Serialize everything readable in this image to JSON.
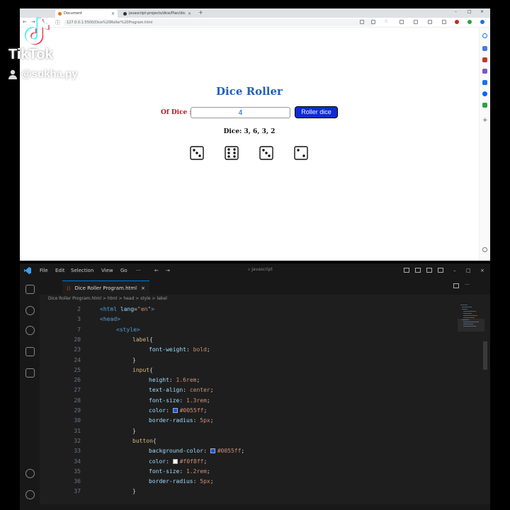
{
  "browser": {
    "tabs": [
      {
        "label": "Document",
        "close": "×"
      },
      {
        "label": "javascript-projects/dice/Plan/dice",
        "close": "×"
      }
    ],
    "new_tab": "+",
    "window_controls": [
      "–",
      "□",
      "×"
    ],
    "url": "127.0.0.1:5500/Dice%20Roller%20Program.html"
  },
  "page": {
    "title": "Dice Roller",
    "dice_label": "Of Dice :",
    "dice_input_value": "4",
    "roll_button": "Roller dice",
    "result_text": "Dice: 3, 6, 3, 2",
    "dice_faces": [
      3,
      6,
      3,
      2
    ]
  },
  "watermark": {
    "brand": "TikTok",
    "username": "@sokha.py"
  },
  "vscode": {
    "menu": [
      "File",
      "Edit",
      "Selection",
      "View",
      "Go",
      "···"
    ],
    "search": "Javascript",
    "tab_label": "Dice Roller Program.html",
    "tab_close": "×",
    "breadcrumb": "Dice Roller Program.html > html > head > style > label",
    "lines": [
      {
        "n": "2",
        "indent": 1,
        "parts": [
          [
            "tag",
            "<html "
          ],
          [
            "prop",
            "lang"
          ],
          [
            "brace",
            "="
          ],
          [
            "val",
            "\"en\""
          ],
          [
            "tag",
            ">"
          ]
        ]
      },
      {
        "n": "3",
        "indent": 1,
        "parts": [
          [
            "tag",
            "<head>"
          ]
        ]
      },
      {
        "n": "7",
        "indent": 2,
        "parts": [
          [
            "tag",
            "<style>"
          ]
        ]
      },
      {
        "n": "20",
        "indent": 3,
        "parts": [
          [
            "sel",
            "label"
          ],
          [
            "brace",
            "{"
          ]
        ]
      },
      {
        "n": "23",
        "indent": 4,
        "parts": [
          [
            "prop",
            "font-weight"
          ],
          [
            "brace",
            ": "
          ],
          [
            "val",
            "bold"
          ],
          [
            "brace",
            ";"
          ]
        ]
      },
      {
        "n": "24",
        "indent": 3,
        "parts": [
          [
            "brace",
            "}"
          ]
        ]
      },
      {
        "n": "25",
        "indent": 3,
        "parts": [
          [
            "sel",
            "input"
          ],
          [
            "brace",
            "{"
          ]
        ]
      },
      {
        "n": "26",
        "indent": 4,
        "parts": [
          [
            "prop",
            "height"
          ],
          [
            "brace",
            ": "
          ],
          [
            "val",
            "1.6rem"
          ],
          [
            "brace",
            ";"
          ]
        ]
      },
      {
        "n": "27",
        "indent": 4,
        "parts": [
          [
            "prop",
            "text-align"
          ],
          [
            "brace",
            ": "
          ],
          [
            "val",
            "center"
          ],
          [
            "brace",
            ";"
          ]
        ]
      },
      {
        "n": "28",
        "indent": 4,
        "parts": [
          [
            "prop",
            "font-size"
          ],
          [
            "brace",
            ": "
          ],
          [
            "val",
            "1.3rem"
          ],
          [
            "brace",
            ";"
          ]
        ]
      },
      {
        "n": "29",
        "indent": 4,
        "parts": [
          [
            "prop",
            "color"
          ],
          [
            "brace",
            ": "
          ],
          [
            "swatch",
            "#0055ff"
          ],
          [
            "val",
            "#0055ff"
          ],
          [
            "brace",
            ";"
          ]
        ]
      },
      {
        "n": "30",
        "indent": 4,
        "parts": [
          [
            "prop",
            "border-radius"
          ],
          [
            "brace",
            ": "
          ],
          [
            "val",
            "5px"
          ],
          [
            "brace",
            ";"
          ]
        ]
      },
      {
        "n": "31",
        "indent": 3,
        "parts": [
          [
            "brace",
            "}"
          ]
        ]
      },
      {
        "n": "32",
        "indent": 3,
        "parts": [
          [
            "sel",
            "button"
          ],
          [
            "brace",
            "{"
          ]
        ]
      },
      {
        "n": "33",
        "indent": 4,
        "parts": [
          [
            "prop",
            "background-color"
          ],
          [
            "brace",
            ": "
          ],
          [
            "swatch",
            "#0055ff"
          ],
          [
            "val",
            "#0055ff"
          ],
          [
            "brace",
            ";"
          ]
        ]
      },
      {
        "n": "34",
        "indent": 4,
        "parts": [
          [
            "prop",
            "color"
          ],
          [
            "brace",
            ": "
          ],
          [
            "swatch",
            "#f0f8ff"
          ],
          [
            "val",
            "#f0f8ff"
          ],
          [
            "brace",
            ";"
          ]
        ]
      },
      {
        "n": "35",
        "indent": 4,
        "parts": [
          [
            "prop",
            "font-size"
          ],
          [
            "brace",
            ": "
          ],
          [
            "val",
            "1.2rem"
          ],
          [
            "brace",
            ";"
          ]
        ]
      },
      {
        "n": "36",
        "indent": 4,
        "parts": [
          [
            "prop",
            "border-radius"
          ],
          [
            "brace",
            ": "
          ],
          [
            "val",
            "5px"
          ],
          [
            "brace",
            ";"
          ]
        ]
      },
      {
        "n": "37",
        "indent": 3,
        "parts": [
          [
            "brace",
            "}"
          ]
        ]
      }
    ]
  },
  "colors": {
    "title_blue": "#1f5fbf",
    "label_red": "#c0141c",
    "button_blue": "#0d2bd6",
    "input_text": "#0055ff"
  }
}
